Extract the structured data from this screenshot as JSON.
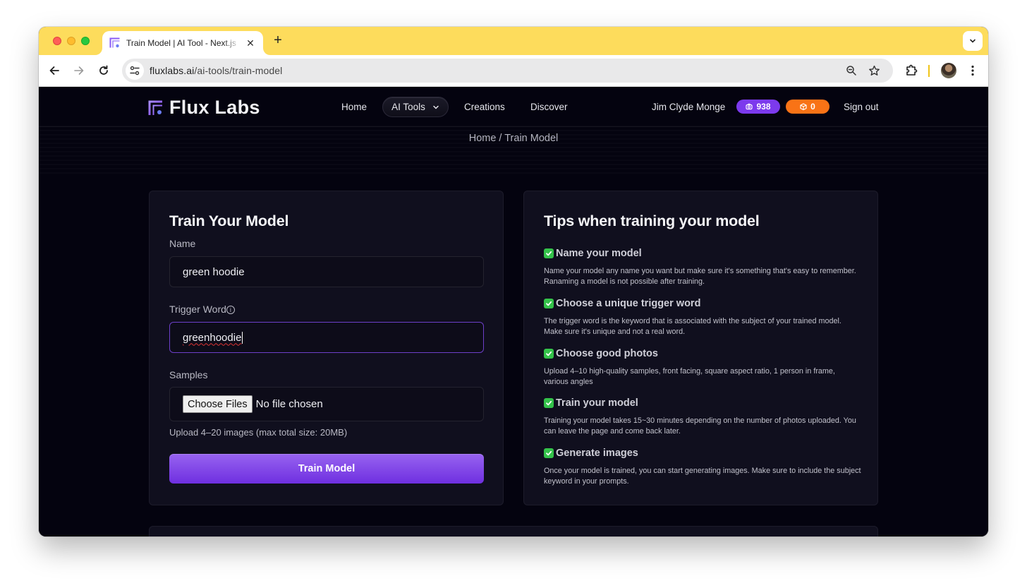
{
  "browser": {
    "tab": {
      "title": "Train Model | AI Tool - Next.js",
      "favicon": "flux-labs-logo-icon"
    },
    "url": {
      "host": "fluxlabs.ai",
      "path": "/ai-tools/train-model"
    },
    "icons": {
      "back": "arrow-left-icon",
      "forward": "arrow-right-icon",
      "reload": "reload-icon",
      "site_info": "tune-icon",
      "zoom": "zoom-out-icon",
      "bookmark": "star-icon",
      "extensions": "puzzle-icon",
      "profile": "avatar",
      "menu": "kebab-menu-icon",
      "tab_search": "chevron-down-icon",
      "new_tab": "plus-icon",
      "close_tab": "close-icon"
    },
    "new_tab_label": "+",
    "close_tab_label": "✕"
  },
  "header": {
    "brand": "Flux Labs",
    "nav": [
      {
        "label": "Home"
      },
      {
        "label": "AI Tools",
        "has_dropdown": true
      },
      {
        "label": "Creations"
      },
      {
        "label": "Discover"
      }
    ],
    "user_name": "Jim Clyde Monge",
    "credits": {
      "value": "938",
      "icon": "camera-icon",
      "color": "#7c3aed"
    },
    "models": {
      "value": "0",
      "icon": "cube-icon",
      "color": "#f97316"
    },
    "sign_out": "Sign out"
  },
  "breadcrumb": {
    "home": "Home",
    "separator": " / ",
    "current": "Train Model"
  },
  "form": {
    "title": "Train Your Model",
    "name": {
      "label": "Name",
      "value": "green hoodie"
    },
    "trigger_word": {
      "label": "Trigger Word",
      "info_icon": "ⓘ",
      "value": "greenhoodie"
    },
    "samples": {
      "label": "Samples",
      "button": "Choose Files",
      "status": "No file chosen"
    },
    "help": "Upload 4–20 images (max total size: 20MB)",
    "submit": "Train Model",
    "accent": "#7c3aed"
  },
  "tips": {
    "title": "Tips when training your model",
    "items": [
      {
        "heading": "Name your model",
        "body": "Name your model any name you want but make sure it's something that's easy to remember. Ranaming a model is not possible after training."
      },
      {
        "heading": "Choose a unique trigger word",
        "body": "The trigger word is the keyword that is associated with the subject of your trained model. Make sure it's unique and not a real word."
      },
      {
        "heading": "Choose good photos",
        "body": "Upload 4–10 high-quality samples, front facing, square aspect ratio, 1 person in frame, various angles"
      },
      {
        "heading": "Train your model",
        "body": "Training your model takes 15~30 minutes depending on the number of photos uploaded. You can leave the page and come back later."
      },
      {
        "heading": "Generate images",
        "body": "Once your model is trained, you can start generating images. Make sure to include the subject keyword in your prompts."
      }
    ]
  }
}
